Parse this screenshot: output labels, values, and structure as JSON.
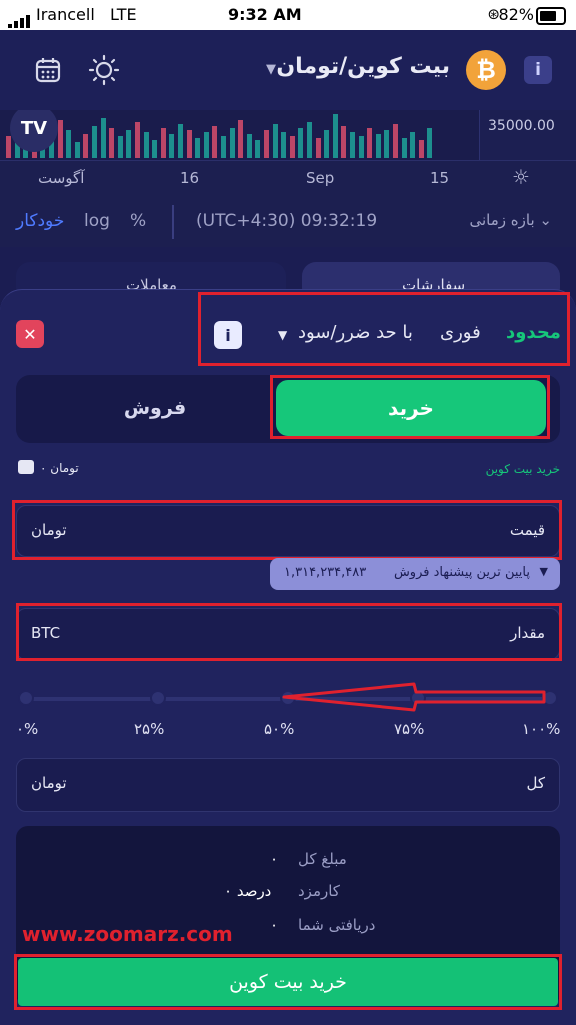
{
  "status": {
    "carrier": "Irancell",
    "network": "LTE",
    "time": "9:32 AM",
    "battery": "82%"
  },
  "header": {
    "pair": "بیت کوین/تومان",
    "coin_symbol": "₿",
    "info": "i",
    "theme_icon": "sun-icon",
    "calendar_icon": "calendar-icon"
  },
  "chart": {
    "price_label": "35000.00",
    "dates": [
      "آگوست",
      "16",
      "Sep",
      "15"
    ],
    "tools": {
      "auto": "خودکار",
      "log": "log",
      "percent": "%",
      "clock": "(UTC+4:30) 09:32:19",
      "range": "بازه زمانی ⌄"
    }
  },
  "sheet": {
    "order_types": {
      "limit": "محدود",
      "market": "فوری",
      "stop": "با حد ضرر/سود"
    },
    "buy_label": "خرید",
    "sell_label": "فروش",
    "buy_coin_label": "خرید بیت کوین",
    "wallet_balance": "۰ تومان",
    "price_label": "قیمت",
    "price_unit": "تومان",
    "lowest_offer_label": "پایین ترین پیشنهاد فروش",
    "lowest_offer_value": "۱,۳۱۴,۲۳۴,۴۸۳",
    "amount_label": "مقدار",
    "amount_unit": "BTC",
    "percents": [
      "۰%",
      "۲۵%",
      "۵۰%",
      "۷۵%",
      "۱۰۰%"
    ],
    "total_label": "کل",
    "total_unit": "تومان",
    "summary": {
      "total_amount_label": "مبلغ کل",
      "total_amount_value": "۰",
      "fee_label": "کارمزد",
      "fee_value": "۰ درصد",
      "received_label": "دریافتی شما",
      "received_value": "۰"
    },
    "cta_label": "خرید بیت کوین"
  },
  "background_tabs": {
    "right": "سفارشات",
    "left": "معاملات"
  },
  "watermark": "www.zoomarz.com",
  "colors": {
    "buy_green": "#16c77a",
    "annotation_red": "#e0212e",
    "close_red": "#e2445c",
    "btc_orange": "#f2a33a"
  }
}
